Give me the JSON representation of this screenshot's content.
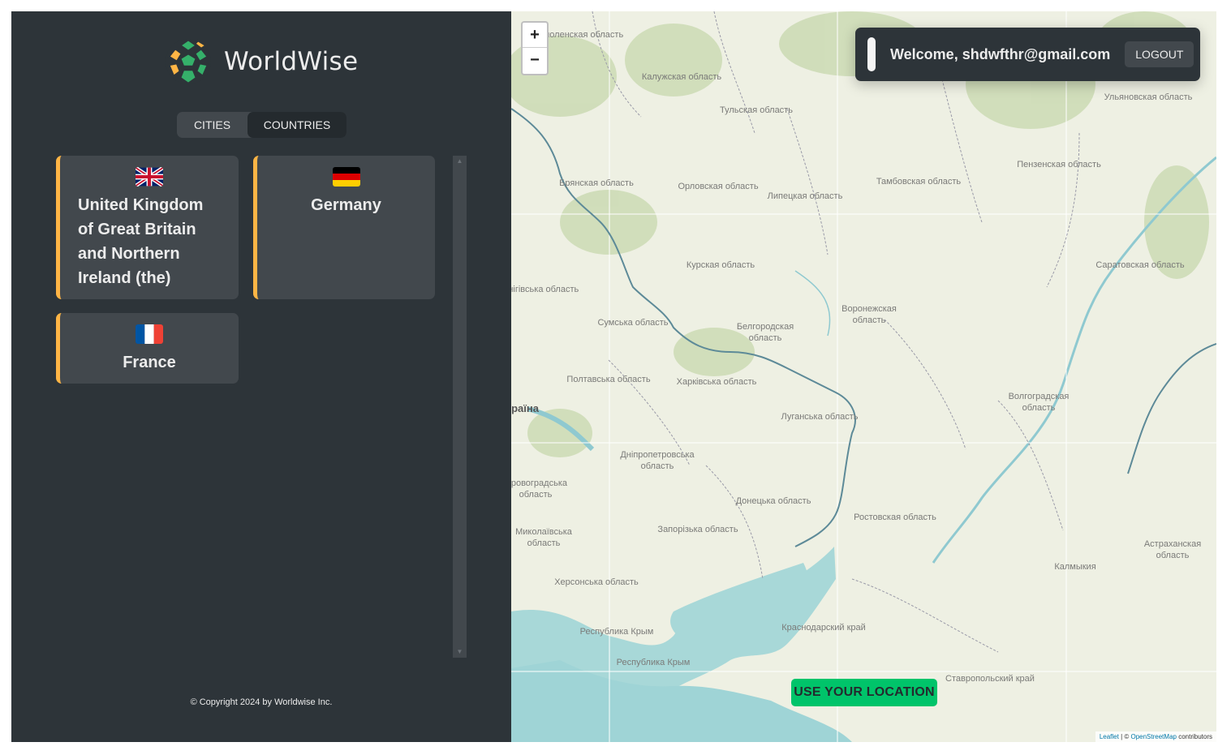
{
  "sidebar": {
    "logo_text": "WorldWise",
    "tabs": [
      "Cities",
      "Countries"
    ],
    "active_tab": "Countries",
    "countries": [
      {
        "name": "United Kingdom of Great Britain and Northern Ireland (the)",
        "flag": "uk-flag-icon"
      },
      {
        "name": "Germany",
        "flag": "germany-flag-icon"
      },
      {
        "name": "France",
        "flag": "france-flag-icon"
      }
    ],
    "copyright": "© Copyright 2024 by Worldwise Inc."
  },
  "map": {
    "zoom_in": "+",
    "zoom_out": "−",
    "welcome": "Welcome, shdwfthr@gmail.com",
    "logout": "Logout",
    "use_location": "USE YOUR LOCATION",
    "attribution": {
      "leaflet": "Leaflet",
      "sep": " | © ",
      "osm": "OpenStreetMap",
      "suffix": " contributors"
    },
    "labels": [
      "Смоленская область",
      "Калужская область",
      "Тульская область",
      "Брянская область",
      "Орловская область",
      "Липецкая область",
      "Тамбовская область",
      "Пензенская область",
      "Ульяновская область",
      "Курская область",
      "Чернігівська область",
      "Сумська область",
      "Белгородская область",
      "Воронежская область",
      "Саратовская область",
      "Полтавська область",
      "Харківська область",
      "Луганська область",
      "Волгоградская область",
      "Україна",
      "Дніпропетровська область",
      "Кіровоградська область",
      "Донецька область",
      "Ростовская область",
      "Миколаївська область",
      "Запорізька область",
      "Астраханская область",
      "Калмыкия",
      "Херсонська область",
      "Республика Крым",
      "Краснодарский край",
      "Республика Крым",
      "Ставропольский край"
    ]
  },
  "colors": {
    "accent": "#ffb545",
    "brand_green": "#00c46a",
    "dark": "#2d3439",
    "card": "#42484d"
  }
}
